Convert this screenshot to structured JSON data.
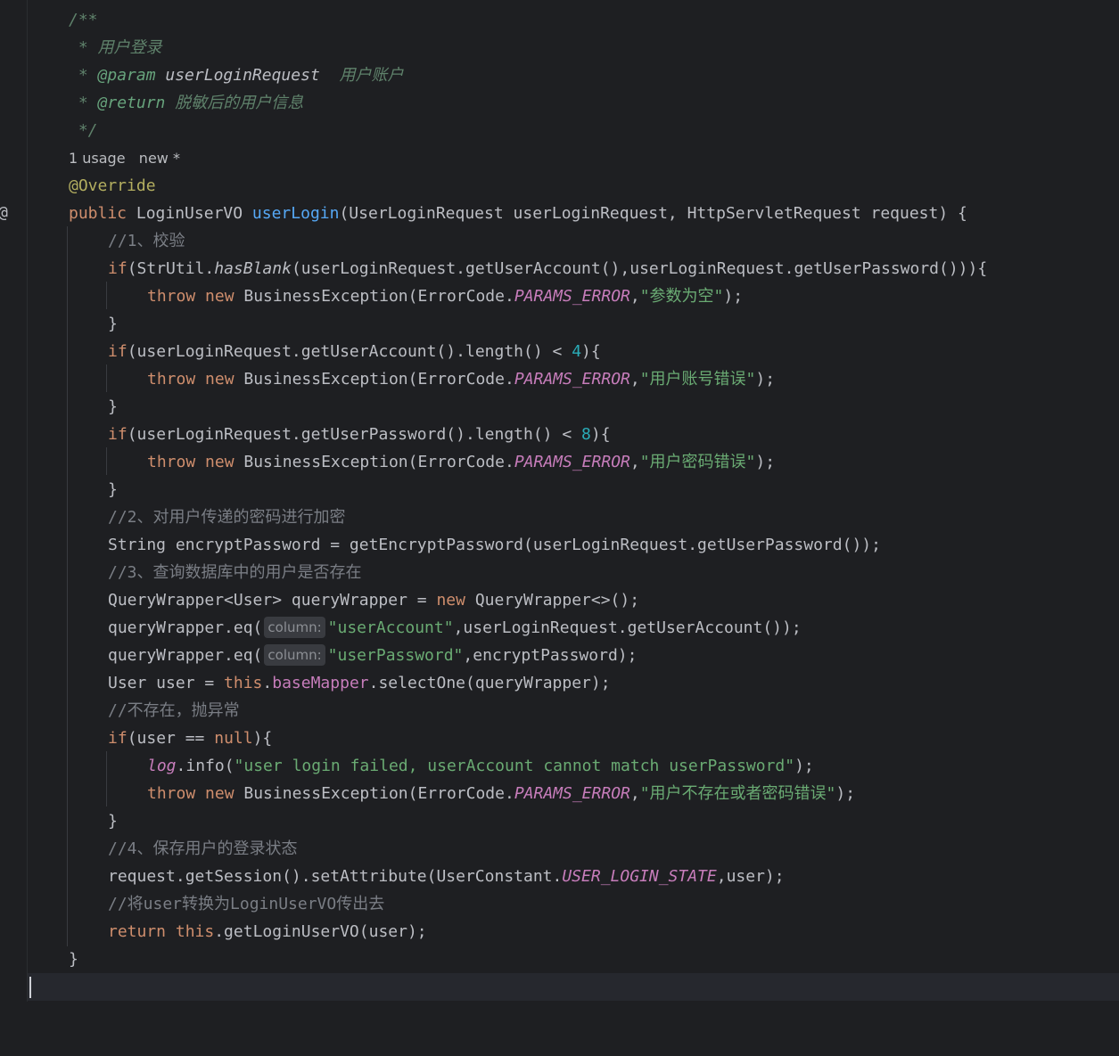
{
  "doc": {
    "open": "/**",
    "desc_prefix": " * ",
    "desc": "用户登录",
    "param_prefix": " * ",
    "param_tag": "@param",
    "param_name": " userLoginRequest",
    "param_desc": "  用户账户",
    "return_prefix": " * ",
    "return_tag": "@return",
    "return_desc": " 脱敏后的用户信息",
    "close": " */"
  },
  "usage_hint": "1 usage   new *",
  "gutter_icon": "@",
  "code": {
    "override": "@Override",
    "sig_kw": "public",
    "sig_type": " LoginUserVO ",
    "sig_fn": "userLogin",
    "sig_rest": "(UserLoginRequest userLoginRequest, HttpServletRequest request) {",
    "c1": "//1、校验",
    "if1_kw": "if",
    "if1_a": "(StrUtil.",
    "if1_fn": "hasBlank",
    "if1_b": "(userLoginRequest.getUserAccount(),userLoginRequest.getUserPassword())){",
    "throw_kw": "throw",
    "new_kw": " new",
    "be_call": " BusinessException(ErrorCode.",
    "params_error": "PARAMS_ERROR",
    "comma": ",",
    "str_empty": "\"参数为空\"",
    "end_call": ");",
    "brace_close": "}",
    "if2_kw": "if",
    "if2_a": "(userLoginRequest.getUserAccount().length() < ",
    "if2_num": "4",
    "if2_b": "){",
    "str_account_err": "\"用户账号错误\"",
    "if3_kw": "if",
    "if3_a": "(userLoginRequest.getUserPassword().length() < ",
    "if3_num": "8",
    "if3_b": "){",
    "str_pwd_err": "\"用户密码错误\"",
    "c2": "//2、对用户传递的密码进行加密",
    "enc_line": "String encryptPassword = getEncryptPassword(userLoginRequest.getUserPassword());",
    "c3": "//3、查询数据库中的用户是否存在",
    "qw_a": "QueryWrapper<User> queryWrapper = ",
    "qw_new": "new",
    "qw_b": " QueryWrapper<>();",
    "eq_call": "queryWrapper.eq(",
    "inlay_column": "column:",
    "str_user_account": "\"userAccount\"",
    "eq1_rest": ",userLoginRequest.getUserAccount());",
    "str_user_password": "\"userPassword\"",
    "eq2_rest": ",encryptPassword);",
    "sel_a": "User user = ",
    "sel_this": "this",
    "sel_dot": ".",
    "sel_field": "baseMapper",
    "sel_b": ".selectOne(queryWrapper);",
    "c4": "//不存在，抛异常",
    "if4_kw": "if",
    "if4_a": "(user == ",
    "if4_null": "null",
    "if4_b": "){",
    "log_name": "log",
    "log_a": ".info(",
    "log_str": "\"user login failed, userAccount cannot match userPassword\"",
    "log_b": ");",
    "str_not_exist": "\"用户不存在或者密码错误\"",
    "c5": "//4、保存用户的登录状态",
    "sess_a": "request.getSession().setAttribute(UserConstant.",
    "sess_const": "USER_LOGIN_STATE",
    "sess_b": ",user);",
    "c6": "//将user转换为LoginUserVO传出去",
    "ret_kw": "return",
    "ret_this": " this",
    "ret_b": ".getLoginUserVO(user);",
    "method_close": "}"
  },
  "colors": {
    "background": "#1e1f22",
    "keyword": "#cf8e6d",
    "function": "#56a8f5",
    "string": "#6aab73",
    "number": "#2aacb8",
    "constant": "#c77dbb",
    "comment": "#7a7e85",
    "annotation": "#b3ae60"
  }
}
